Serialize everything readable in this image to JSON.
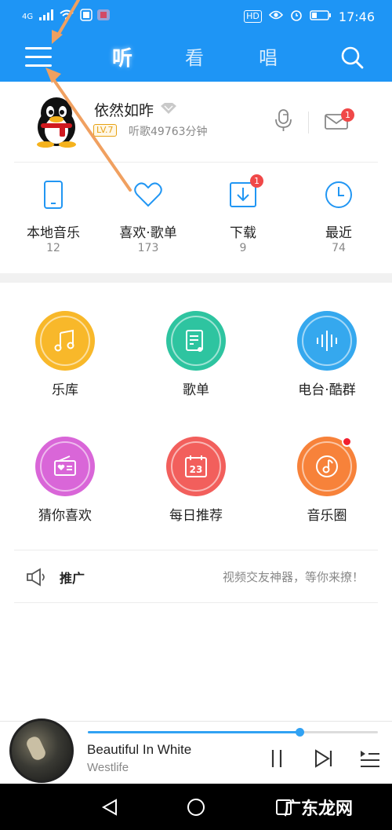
{
  "status_bar": {
    "network": "4G",
    "hd_label": "HD",
    "battery_label": "",
    "time": "17:46"
  },
  "top_nav": {
    "tabs": [
      {
        "label": "听",
        "active": true
      },
      {
        "label": "看",
        "active": false
      },
      {
        "label": "唱",
        "active": false
      }
    ]
  },
  "profile": {
    "username": "依然如昨",
    "level": "LV.7",
    "listen_time": "听歌49763分钟",
    "mail_badge": "1"
  },
  "shortcuts": [
    {
      "label": "本地音乐",
      "count": "12",
      "icon": "phone-icon"
    },
    {
      "label": "喜欢·歌单",
      "count": "173",
      "icon": "heart-icon"
    },
    {
      "label": "下载",
      "count": "9",
      "icon": "download-icon",
      "badge": "1"
    },
    {
      "label": "最近",
      "count": "74",
      "icon": "clock-icon"
    }
  ],
  "features": [
    {
      "label": "乐库",
      "icon": "music-note-icon",
      "color": "#f8b82a"
    },
    {
      "label": "歌单",
      "icon": "playlist-icon",
      "color": "#2ec4a0"
    },
    {
      "label": "电台·酷群",
      "icon": "soundwave-icon",
      "color": "#35a8ee"
    },
    {
      "label": "猜你喜欢",
      "icon": "radio-heart-icon",
      "color": "#d966d8"
    },
    {
      "label": "每日推荐",
      "icon": "calendar-icon",
      "color": "#f25f5c",
      "calendar_day": "23"
    },
    {
      "label": "音乐圈",
      "icon": "music-circle-icon",
      "color": "#f7823a",
      "dot": true
    }
  ],
  "promo": {
    "label": "推广",
    "text": "视频交友神器，等你来撩！"
  },
  "player": {
    "title": "Beautiful In White",
    "artist": "Westlife",
    "progress": 0.73
  },
  "watermark": "广东龙网",
  "colors": {
    "accent": "#1e95f5",
    "badge": "#f04848",
    "tutorial_arrow": "#f0a060"
  }
}
